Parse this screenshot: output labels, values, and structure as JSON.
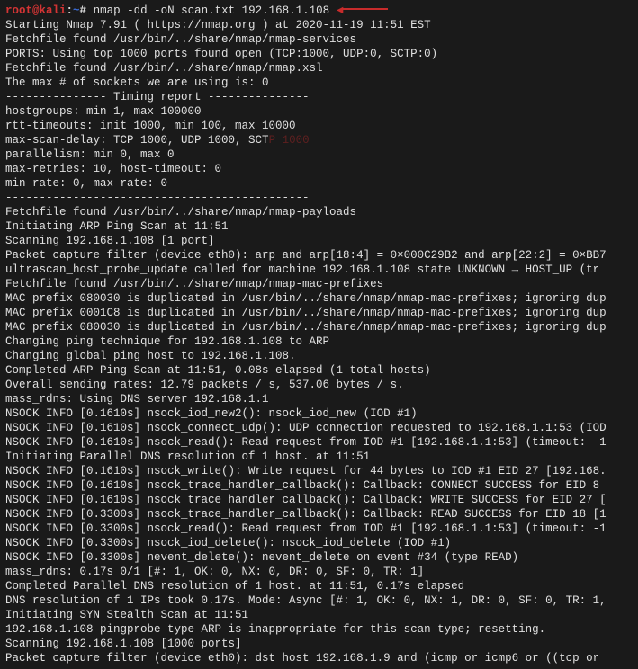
{
  "prompt": {
    "user": "root@kali",
    "path": "~",
    "symbol": "#"
  },
  "command": "nmap -dd -oN  scan.txt 192.168.1.108",
  "arrow": "◄",
  "output": {
    "l1": "Starting Nmap 7.91 ( https://nmap.org ) at 2020-11-19 11:51 EST",
    "l2": "Fetchfile found /usr/bin/../share/nmap/nmap-services",
    "l3": "PORTS: Using top 1000 ports found open (TCP:1000, UDP:0, SCTP:0)",
    "l4": "Fetchfile found /usr/bin/../share/nmap/nmap.xsl",
    "l5": "The max # of sockets we are using is: 0",
    "dash1": "--------------- Timing report ---------------",
    "l6": "  hostgroups: min 1, max 100000",
    "l7": "  rtt-timeouts: init 1000, min 100, max 10000",
    "l8a": "  max-scan-delay: TCP 1000, UDP 1000, SCT",
    "l8b": "P 1000",
    "l9": "  parallelism: min 0, max 0",
    "l10": "  max-retries: 10, host-timeout: 0",
    "l11": "  min-rate: 0, max-rate: 0",
    "dash2": "---------------------------------------------",
    "l12": "Fetchfile found /usr/bin/../share/nmap/nmap-payloads",
    "l13": "Initiating ARP Ping Scan at 11:51",
    "l14": "Scanning 192.168.1.108 [1 port]",
    "l15": "Packet capture filter (device eth0): arp and arp[18:4] = 0×000C29B2 and arp[22:2] = 0×BB7",
    "l16": "ultrascan_host_probe_update called for machine 192.168.1.108 state UNKNOWN → HOST_UP (tr",
    "l17": "Fetchfile found /usr/bin/../share/nmap/nmap-mac-prefixes",
    "l18": "MAC prefix 080030 is duplicated in /usr/bin/../share/nmap/nmap-mac-prefixes; ignoring dup",
    "l19": "MAC prefix 0001C8 is duplicated in /usr/bin/../share/nmap/nmap-mac-prefixes; ignoring dup",
    "l20": "MAC prefix 080030 is duplicated in /usr/bin/../share/nmap/nmap-mac-prefixes; ignoring dup",
    "l21": "Changing ping technique for 192.168.1.108 to ARP",
    "l22": "Changing global ping host to 192.168.1.108.",
    "l23": "Completed ARP Ping Scan at 11:51, 0.08s elapsed (1 total hosts)",
    "l24": "Overall sending rates: 12.79 packets / s, 537.06 bytes / s.",
    "l25": "mass_rdns: Using DNS server 192.168.1.1",
    "l26": "NSOCK INFO [0.1610s] nsock_iod_new2(): nsock_iod_new (IOD #1)",
    "l27": "NSOCK INFO [0.1610s] nsock_connect_udp(): UDP connection requested to 192.168.1.1:53 (IOD",
    "l28": "NSOCK INFO [0.1610s] nsock_read(): Read request from IOD #1 [192.168.1.1:53] (timeout: -1",
    "l29": "Initiating Parallel DNS resolution of 1 host. at 11:51",
    "l30": "NSOCK INFO [0.1610s] nsock_write(): Write request for 44 bytes to IOD #1 EID 27 [192.168.",
    "l31": "NSOCK INFO [0.1610s] nsock_trace_handler_callback(): Callback: CONNECT SUCCESS for EID 8 ",
    "l32": "NSOCK INFO [0.1610s] nsock_trace_handler_callback(): Callback: WRITE SUCCESS for EID 27 [",
    "l33": "NSOCK INFO [0.3300s] nsock_trace_handler_callback(): Callback: READ SUCCESS for EID 18 [1",
    "l34": "NSOCK INFO [0.3300s] nsock_read(): Read request from IOD #1 [192.168.1.1:53] (timeout: -1",
    "l35": "NSOCK INFO [0.3300s] nsock_iod_delete(): nsock_iod_delete (IOD #1)",
    "l36": "NSOCK INFO [0.3300s] nevent_delete(): nevent_delete on event #34 (type READ)",
    "l37": "mass_rdns: 0.17s 0/1 [#: 1, OK: 0, NX: 0, DR: 0, SF: 0, TR: 1]",
    "l38": "Completed Parallel DNS resolution of 1 host. at 11:51, 0.17s elapsed",
    "l39": "DNS resolution of 1 IPs took 0.17s. Mode: Async [#: 1, OK: 0, NX: 1, DR: 0, SF: 0, TR: 1,",
    "l40": "Initiating SYN Stealth Scan at 11:51",
    "l41": "192.168.1.108 pingprobe type ARP is inappropriate for this scan type; resetting.",
    "l42": "Scanning 192.168.1.108 [1000 ports]",
    "l43": "Packet capture filter (device eth0): dst host 192.168.1.9 and (icmp or icmp6 or ((tcp or "
  }
}
